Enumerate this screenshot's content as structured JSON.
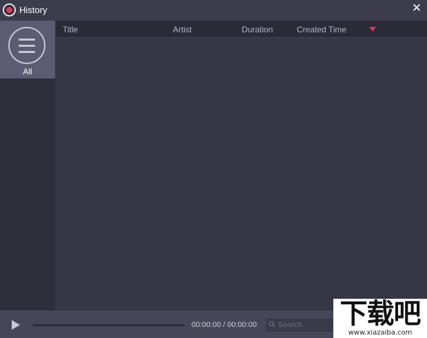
{
  "window": {
    "title": "History",
    "close_symbol": "✕"
  },
  "sidebar": {
    "items": [
      {
        "label": "All",
        "icon": "list-menu-icon",
        "selected": true
      }
    ]
  },
  "list": {
    "columns": [
      "Title",
      "Artist",
      "Duration",
      "Created Time"
    ],
    "sort_column": "Created Time",
    "sort_direction": "descending",
    "rows": []
  },
  "player": {
    "time_display": "00:00:00 / 00:00:00",
    "search_placeholder": "Search"
  },
  "watermark": {
    "cjk_text": "下载吧",
    "url": "www.xiazaiba.com"
  },
  "colors": {
    "accent": "#e0344f",
    "selected_item_bg": "#5b5b73",
    "background": "#363645"
  }
}
